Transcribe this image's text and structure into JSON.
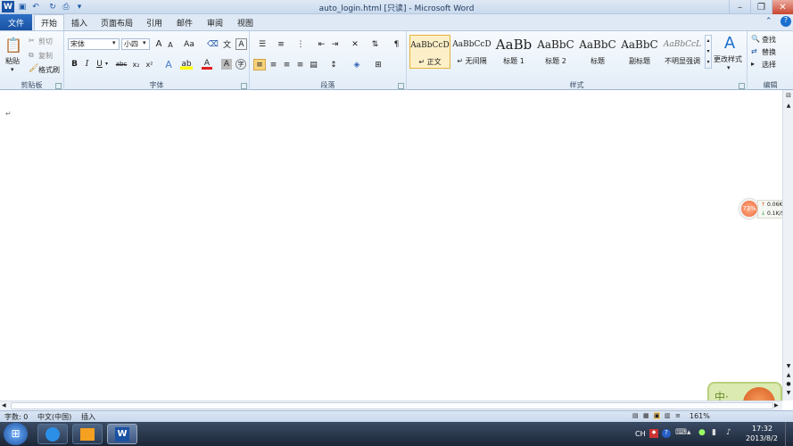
{
  "window": {
    "title": "auto_login.html [只读] - Microsoft Word",
    "min_icon": "minimize-icon",
    "max_icon": "restore-icon",
    "close_icon": "close-icon"
  },
  "quick_access": {
    "items": [
      "word-logo-icon",
      "save-icon",
      "undo-icon",
      "redo-icon",
      "customize-icon"
    ]
  },
  "tabs": [
    "文件",
    "开始",
    "插入",
    "页面布局",
    "引用",
    "邮件",
    "审阅",
    "视图"
  ],
  "clipboard": {
    "paste": "粘贴",
    "cut": "剪切",
    "copy": "复制",
    "format_painter": "格式刷",
    "label": "剪贴板"
  },
  "font": {
    "name": "宋体",
    "size": "小四",
    "bold": "B",
    "italic": "I",
    "underline": "U",
    "strike": "abc",
    "sub": "x₂",
    "sup": "x²",
    "grow": "A",
    "shrink": "A",
    "case": "Aa",
    "label": "字体"
  },
  "paragraph": {
    "label": "段落"
  },
  "styles": {
    "items": [
      {
        "preview": "AaBbCcD",
        "name": "↵ 正文"
      },
      {
        "preview": "AaBbCcD",
        "name": "↵ 无间隔"
      },
      {
        "preview": "AaBb",
        "name": "标题 1"
      },
      {
        "preview": "AaBbC",
        "name": "标题 2"
      },
      {
        "preview": "AaBbC",
        "name": "标题"
      },
      {
        "preview": "AaBbC",
        "name": "副标题"
      },
      {
        "preview": "AaBbCcL",
        "name": "不明显强调"
      }
    ],
    "change": "更改样式",
    "label": "样式"
  },
  "editing": {
    "find": "查找",
    "replace": "替换",
    "select": "选择",
    "label": "编辑"
  },
  "document": {
    "mark": "↵"
  },
  "net_widget": {
    "percent": "73%",
    "up": "0.06K/S",
    "down": "0.1K/S"
  },
  "mascot": {
    "text": "中·简"
  },
  "status": {
    "words": "字数: 0",
    "language": "中文(中国)",
    "mode": "插入",
    "zoom": "161%"
  },
  "taskbar": {
    "tray_lang": "CH",
    "time": "17:32",
    "date": "2013/8/2"
  },
  "colors": {
    "accent": "#1a52a3",
    "ribbon": "#e3edf8",
    "taskbar": "#1c2738"
  }
}
